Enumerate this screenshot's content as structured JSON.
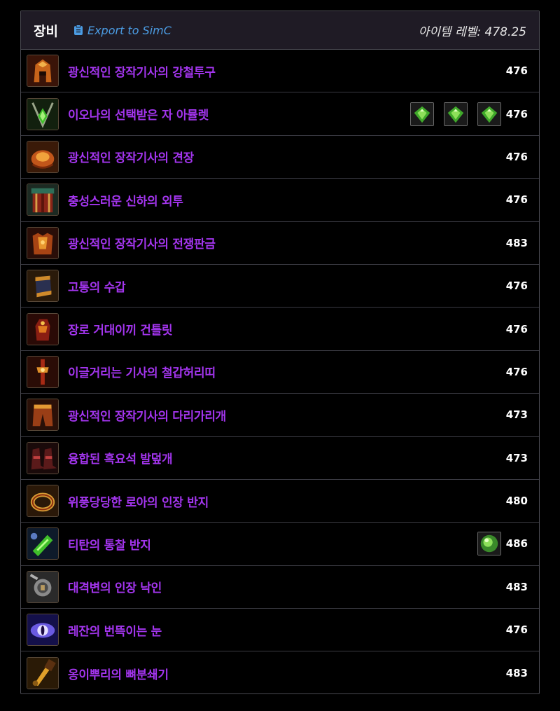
{
  "header": {
    "title": "장비",
    "export_label": "Export to SimC",
    "item_level": "아이템 레벨: 478.25"
  },
  "colors": {
    "epic": "#a335ee",
    "link": "#4b9ce3",
    "gem_green": "#4fc23a"
  },
  "items": [
    {
      "name": "광신적인 장작기사의 강철투구",
      "level": "476",
      "icon": "helm-icon",
      "gems": 0
    },
    {
      "name": "이오나의 선택받은 자 아뮬렛",
      "level": "476",
      "icon": "amulet-icon",
      "gems": 3
    },
    {
      "name": "광신적인 장작기사의 견장",
      "level": "476",
      "icon": "shoulder-icon",
      "gems": 0
    },
    {
      "name": "충성스러운 신하의 외투",
      "level": "476",
      "icon": "cloak-icon",
      "gems": 0
    },
    {
      "name": "광신적인 장작기사의 전쟁판금",
      "level": "483",
      "icon": "chest-icon",
      "gems": 0
    },
    {
      "name": "고통의 수갑",
      "level": "476",
      "icon": "bracer-icon",
      "gems": 0
    },
    {
      "name": "장로 거대이끼 건틀릿",
      "level": "476",
      "icon": "gauntlet-icon",
      "gems": 0
    },
    {
      "name": "이글거리는 기사의 철갑허리띠",
      "level": "476",
      "icon": "belt-icon",
      "gems": 0
    },
    {
      "name": "광신적인 장작기사의 다리가리개",
      "level": "473",
      "icon": "legs-icon",
      "gems": 0
    },
    {
      "name": "융합된 흑요석 발덮개",
      "level": "473",
      "icon": "boots-icon",
      "gems": 0
    },
    {
      "name": "위풍당당한 로아의 인장 반지",
      "level": "480",
      "icon": "ring-icon",
      "gems": 0
    },
    {
      "name": "티탄의 통찰 반지",
      "level": "486",
      "icon": "ring-gem-icon",
      "gems": 1
    },
    {
      "name": "대격변의 인장 낙인",
      "level": "483",
      "icon": "trinket-seal-icon",
      "gems": 0
    },
    {
      "name": "레잔의 번뜩이는 눈",
      "level": "476",
      "icon": "trinket-eye-icon",
      "gems": 0
    },
    {
      "name": "옹이뿌리의 뼈분쇄기",
      "level": "483",
      "icon": "weapon-icon",
      "gems": 0
    }
  ]
}
